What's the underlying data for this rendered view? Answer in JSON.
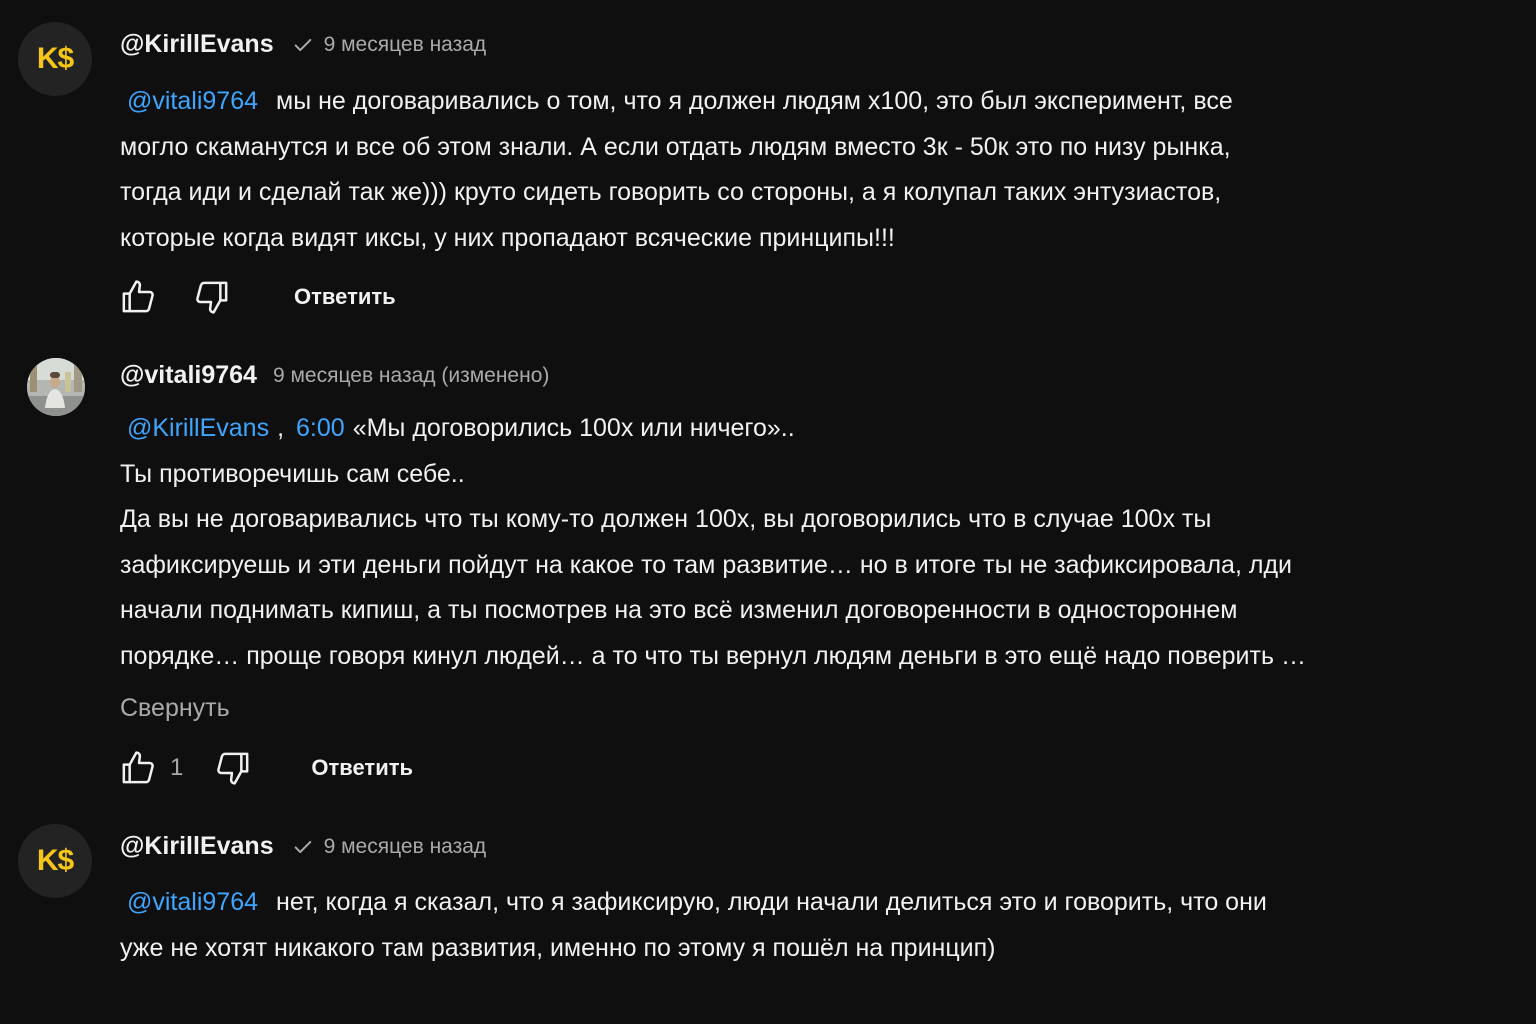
{
  "comments": [
    {
      "author": "@KirillEvans",
      "avatar_text": "K$",
      "time": "9 месяцев назад",
      "mention": "@vitali9764",
      "lines": [
        "мы не договаривались о том, что я должен людям х100, это был эксперимент, все",
        "могло скаманутся и все об этом знали. А если отдать людям вместо 3к - 50к это по низу рынка,",
        "тогда иди и сделай так же))) круто сидеть говорить со стороны, а я колупал таких энтузиастов,",
        "которые когда видят иксы, у них пропадают всяческие принципы!!!"
      ],
      "reply_label": "Ответить"
    },
    {
      "author": "@vitali9764",
      "time": "9 месяцев назад (изменено)",
      "mention": "@KirillEvans",
      "separator": ",",
      "timestamp_link": "6:00",
      "first_line_text": "«Мы договорились 100х или ничего»..",
      "lines": [
        "Ты противоречишь сам себе..",
        "Да вы не договаривались что ты кому-то должен 100х, вы договорились что в случае 100х ты",
        "зафиксируешь и эти деньги пойдут на какое то там развитие… но в итоге ты не зафиксировала, лди",
        "начали поднимать кипиш, а ты посмотрев на это всё изменил договоренности в одностороннем",
        "порядке… проще говоря кинул людей… а то что ты вернул людям деньги в это ещё надо поверить …"
      ],
      "collapse_label": "Свернуть",
      "like_count": "1",
      "reply_label": "Ответить"
    },
    {
      "author": "@KirillEvans",
      "avatar_text": "K$",
      "time": "9 месяцев назад",
      "mention": "@vitali9764",
      "lines": [
        "нет, когда я сказал, что я зафиксирую, люди начали делиться это и говорить, что они",
        "уже не хотят никакого там развития, именно по этому я пошёл на принцип)"
      ]
    }
  ],
  "icons": {
    "verified": "check-icon",
    "like": "thumbs-up-icon",
    "dislike": "thumbs-down-icon"
  },
  "colors": {
    "background": "#0f0f0f",
    "link": "#3ea6ff",
    "avatar_text": "#f5c518",
    "secondary_text": "#aaaaaa"
  }
}
